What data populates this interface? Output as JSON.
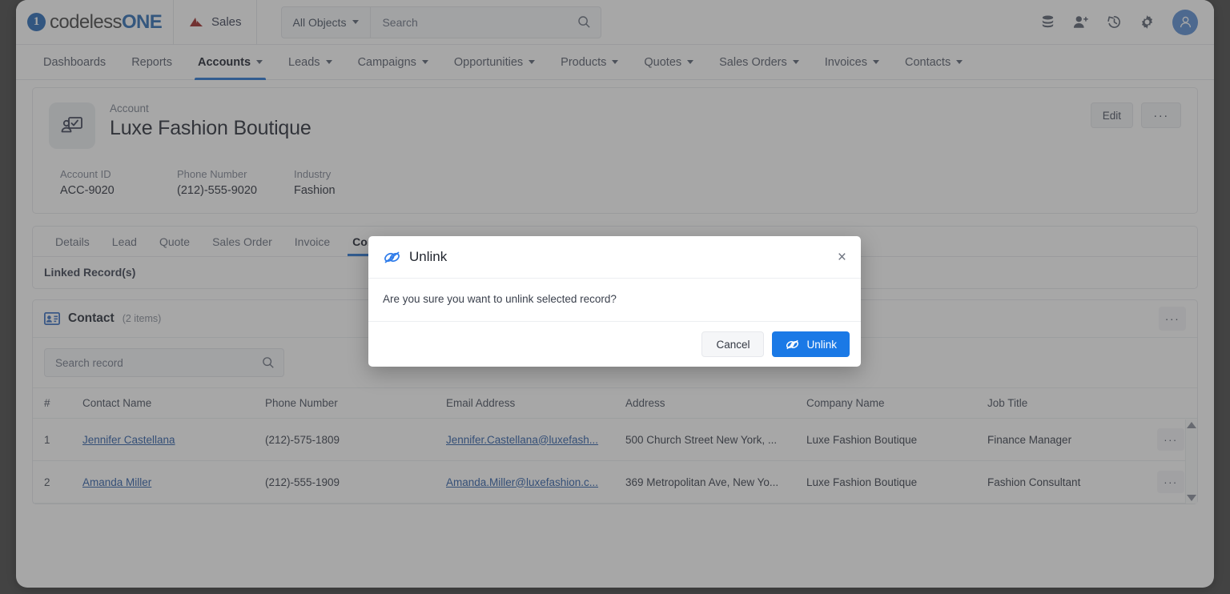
{
  "topbar": {
    "brand_number": "1",
    "brand_part1": "codeless",
    "brand_part2": "ONE",
    "app_name": "Sales",
    "object_select": "All Objects",
    "search_placeholder": "Search",
    "search_value": "",
    "icons": [
      "database-icon",
      "add-user-icon",
      "history-icon",
      "gear-icon",
      "user-avatar-icon"
    ]
  },
  "nav": {
    "items": [
      {
        "label": "Dashboards",
        "has_caret": false,
        "active": false
      },
      {
        "label": "Reports",
        "has_caret": false,
        "active": false
      },
      {
        "label": "Accounts",
        "has_caret": true,
        "active": true
      },
      {
        "label": "Leads",
        "has_caret": true,
        "active": false
      },
      {
        "label": "Campaigns",
        "has_caret": true,
        "active": false
      },
      {
        "label": "Opportunities",
        "has_caret": true,
        "active": false
      },
      {
        "label": "Products",
        "has_caret": true,
        "active": false
      },
      {
        "label": "Quotes",
        "has_caret": true,
        "active": false
      },
      {
        "label": "Sales Orders",
        "has_caret": true,
        "active": false
      },
      {
        "label": "Invoices",
        "has_caret": true,
        "active": false
      },
      {
        "label": "Contacts",
        "has_caret": true,
        "active": false
      }
    ]
  },
  "record": {
    "kicker": "Account",
    "title": "Luxe Fashion Boutique",
    "edit_label": "Edit",
    "more_label": "···",
    "fields": [
      {
        "key": "Account ID",
        "value": "ACC-9020"
      },
      {
        "key": "Phone Number",
        "value": "(212)-555-9020"
      },
      {
        "key": "Industry",
        "value": "Fashion"
      }
    ]
  },
  "subtabs": {
    "items": [
      {
        "label": "Details",
        "active": false
      },
      {
        "label": "Lead",
        "active": false
      },
      {
        "label": "Quote",
        "active": false
      },
      {
        "label": "Sales Order",
        "active": false
      },
      {
        "label": "Invoice",
        "active": false
      },
      {
        "label": "Contact",
        "active": true
      }
    ],
    "linked_label": "Linked Record(s)"
  },
  "contact_card": {
    "title": "Contact",
    "count": "(2 items)",
    "more_label": "···",
    "search_placeholder": "Search record",
    "search_value": "",
    "columns": [
      "#",
      "Contact Name",
      "Phone Number",
      "Email Address",
      "Address",
      "Company Name",
      "Job Title",
      ""
    ],
    "rows": [
      {
        "num": "1",
        "name": "Jennifer Castellana",
        "phone": "(212)-575-1809",
        "email": "Jennifer.Castellana@luxefash...",
        "address": "500 Church Street New York, ...",
        "company": "Luxe Fashion Boutique",
        "job": "Finance Manager",
        "more": "···"
      },
      {
        "num": "2",
        "name": "Amanda Miller",
        "phone": "(212)-555-1909",
        "email": "Amanda.Miller@luxefashion.c...",
        "address": "369 Metropolitan Ave, New Yo...",
        "company": "Luxe Fashion Boutique",
        "job": "Fashion Consultant",
        "more": "···"
      }
    ]
  },
  "modal": {
    "title": "Unlink",
    "close_label": "×",
    "message": "Are you sure you want to unlink selected record?",
    "cancel_label": "Cancel",
    "confirm_label": "Unlink"
  },
  "colors": {
    "accent_blue": "#2a77d4",
    "primary_button": "#1a79e6",
    "link": "#2f5fa8",
    "brand_blue": "#2f6db5",
    "sales_red": "#9e2a2a"
  }
}
